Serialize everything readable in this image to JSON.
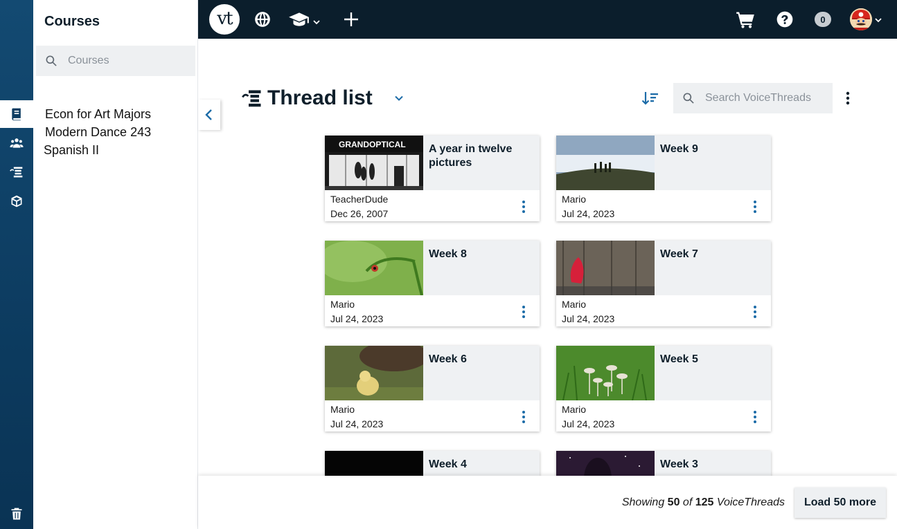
{
  "sidebar": {
    "title": "Courses",
    "search_placeholder": "Courses",
    "courses": [
      "Econ for Art Majors",
      "Modern Dance 243",
      "Spanish II"
    ]
  },
  "topbar": {
    "logo_text": "vt",
    "cart_count": "0"
  },
  "main": {
    "title": "Thread list",
    "search_placeholder": "Search VoiceThreads"
  },
  "threads": [
    {
      "title": "A year in twelve pictures",
      "author": "TeacherDude",
      "date": "Dec 26, 2007"
    },
    {
      "title": "Week 9",
      "author": "Mario",
      "date": "Jul 24, 2023"
    },
    {
      "title": "Week 8",
      "author": "Mario",
      "date": "Jul 24, 2023"
    },
    {
      "title": "Week 7",
      "author": "Mario",
      "date": "Jul 24, 2023"
    },
    {
      "title": "Week 6",
      "author": "Mario",
      "date": "Jul 24, 2023"
    },
    {
      "title": "Week 5",
      "author": "Mario",
      "date": "Jul 24, 2023"
    },
    {
      "title": "Week 4",
      "author": "",
      "date": ""
    },
    {
      "title": "Week 3",
      "author": "",
      "date": ""
    }
  ],
  "thumbnail_text": {
    "store_sign": "GRANDOPTICAL"
  },
  "footer": {
    "showing_prefix": "Showing",
    "shown_count": "50",
    "of_label": "of",
    "total_count": "125",
    "items_label": "VoiceThreads",
    "load_more_label": "Load 50 more"
  },
  "colors": {
    "rail": "#0d3d62",
    "topbar": "#0b1e2c",
    "accent": "#1d6ca8",
    "card_title_bg": "#eff1f3"
  },
  "icons": {
    "rail": [
      "book-icon",
      "people-icon",
      "threads-icon",
      "box-icon",
      "trash-icon"
    ],
    "topbar": [
      "globe-icon",
      "graduation-cap-icon",
      "plus-icon",
      "cart-icon",
      "help-icon"
    ]
  }
}
